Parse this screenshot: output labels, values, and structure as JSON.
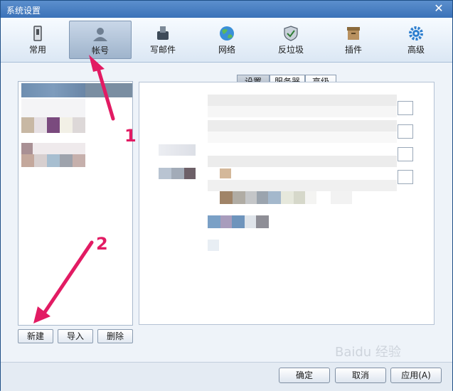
{
  "window": {
    "title": "系统设置",
    "close_glyph": "✕"
  },
  "toolbar": {
    "items": [
      {
        "label": "常用",
        "icon": "phone-icon"
      },
      {
        "label": "帐号",
        "icon": "person-icon"
      },
      {
        "label": "写邮件",
        "icon": "compose-icon"
      },
      {
        "label": "网络",
        "icon": "globe-icon"
      },
      {
        "label": "反垃圾",
        "icon": "shield-icon"
      },
      {
        "label": "插件",
        "icon": "box-icon"
      },
      {
        "label": "高级",
        "icon": "gear-icon"
      }
    ],
    "active_index": 1
  },
  "left_buttons": {
    "new": "新建",
    "import": "导入",
    "delete": "删除"
  },
  "tabs": [
    "设置",
    "服务器",
    "高级"
  ],
  "footer": {
    "ok": "确定",
    "cancel": "取消",
    "apply": "应用(A)"
  },
  "annotations": {
    "one": "1",
    "two": "2"
  },
  "watermark": "Baidu 经验",
  "colors": {
    "titlebar": "#3b72b8",
    "annotation": "#e21b63"
  }
}
